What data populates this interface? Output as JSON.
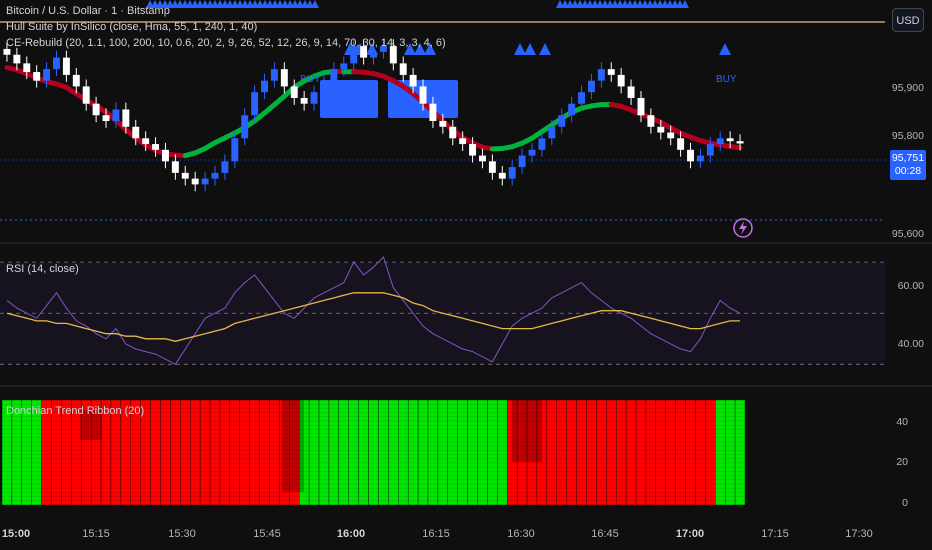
{
  "title": "Bitcoin / U.S. Dollar · 1 · Bitstamp",
  "indicators": {
    "hull": "Hull Suite by InSilico (close, Hma, 55, 1, 240, 1, 40)",
    "ce": "CE-Rebuild (20, 1.1, 100, 200, 10, 0.6, 20, 2, 9, 26, 52, 12, 26, 9, 14, 70, 30, 14, 3, 3, 4, 6)",
    "rsi": "RSI (14, close)",
    "donchian": "Donchian Trend Ribbon (20)"
  },
  "currency_button": "USD",
  "buy_label": "BUY",
  "price_axis": [
    "95,900",
    "95,800",
    "95,600"
  ],
  "current_price": "95,751",
  "countdown": "00:28",
  "rsi_axis": [
    "60.00",
    "40.00"
  ],
  "ribbon_axis": [
    "40",
    "20",
    "0"
  ],
  "time_axis": [
    {
      "label": "15:00",
      "bold": true
    },
    {
      "label": "15:15",
      "bold": false
    },
    {
      "label": "15:30",
      "bold": false
    },
    {
      "label": "15:45",
      "bold": false
    },
    {
      "label": "16:00",
      "bold": true
    },
    {
      "label": "16:15",
      "bold": false
    },
    {
      "label": "16:30",
      "bold": false
    },
    {
      "label": "16:45",
      "bold": false
    },
    {
      "label": "17:00",
      "bold": true
    },
    {
      "label": "17:15",
      "bold": false
    },
    {
      "label": "17:30",
      "bold": false
    }
  ],
  "colors": {
    "bull": "#2962ff",
    "bear": "#ffffff",
    "hull_up": "#00b33c",
    "hull_down": "#b2001f",
    "rsi": "#7e57c2",
    "rsi_ma": "#e5b84a",
    "ribbon_up": "#00e600",
    "ribbon_down": "#ff0000"
  },
  "chart_data": {
    "type": "candlestick",
    "timeframe_minutes": 1,
    "price_close": [
      95905,
      95890,
      95875,
      95860,
      95880,
      95900,
      95870,
      95850,
      95820,
      95800,
      95790,
      95810,
      95780,
      95760,
      95750,
      95740,
      95720,
      95700,
      95690,
      95680,
      95690,
      95700,
      95720,
      95760,
      95800,
      95840,
      95860,
      95880,
      95850,
      95830,
      95820,
      95840,
      95860,
      95880,
      95890,
      95920,
      95900,
      95910,
      95920,
      95890,
      95870,
      95850,
      95820,
      95790,
      95780,
      95760,
      95750,
      95730,
      95720,
      95700,
      95690,
      95710,
      95730,
      95740,
      95760,
      95780,
      95800,
      95820,
      95840,
      95860,
      95880,
      95870,
      95850,
      95830,
      95800,
      95780,
      95770,
      95760,
      95740,
      95720,
      95730,
      95750,
      95760,
      95755,
      95751
    ],
    "rsi": [
      55,
      52,
      50,
      48,
      53,
      58,
      52,
      47,
      45,
      42,
      40,
      44,
      38,
      36,
      35,
      34,
      32,
      30,
      36,
      42,
      48,
      50,
      52,
      58,
      62,
      65,
      60,
      55,
      50,
      48,
      52,
      56,
      58,
      60,
      62,
      70,
      65,
      68,
      72,
      60,
      55,
      50,
      45,
      42,
      40,
      38,
      36,
      35,
      33,
      31,
      38,
      45,
      48,
      50,
      52,
      56,
      58,
      60,
      62,
      58,
      55,
      52,
      50,
      48,
      45,
      42,
      40,
      38,
      36,
      35,
      40,
      48,
      55,
      52,
      50
    ],
    "rsi_ma": [
      50,
      49,
      48,
      47,
      47,
      46,
      46,
      45,
      44,
      43,
      42,
      42,
      41,
      41,
      40,
      40,
      40,
      39,
      40,
      41,
      42,
      43,
      44,
      46,
      47,
      48,
      49,
      50,
      51,
      52,
      53,
      54,
      55,
      56,
      57,
      58,
      58,
      58,
      58,
      57,
      56,
      54,
      53,
      51,
      50,
      49,
      48,
      47,
      46,
      45,
      44,
      44,
      44,
      44,
      45,
      46,
      47,
      48,
      49,
      50,
      51,
      51,
      51,
      50,
      49,
      48,
      47,
      46,
      45,
      44,
      44,
      45,
      46,
      47,
      47
    ],
    "donchian_trend": [
      "up",
      "up",
      "up",
      "up",
      "down",
      "down",
      "down",
      "down",
      "down",
      "down",
      "down",
      "down",
      "down",
      "down",
      "down",
      "down",
      "down",
      "down",
      "down",
      "down",
      "down",
      "down",
      "down",
      "down",
      "down",
      "down",
      "down",
      "down",
      "down",
      "down",
      "up",
      "up",
      "up",
      "up",
      "up",
      "up",
      "up",
      "up",
      "up",
      "up",
      "up",
      "up",
      "up",
      "up",
      "up",
      "up",
      "up",
      "up",
      "up",
      "up",
      "up",
      "down",
      "down",
      "down",
      "down",
      "down",
      "down",
      "down",
      "down",
      "down",
      "down",
      "down",
      "down",
      "down",
      "down",
      "down",
      "down",
      "down",
      "down",
      "down",
      "down",
      "down",
      "up",
      "up",
      "up"
    ],
    "price_range": [
      95580,
      96000
    ],
    "rsi_range": [
      27,
      72
    ],
    "ribbon_range": [
      0,
      50
    ]
  }
}
